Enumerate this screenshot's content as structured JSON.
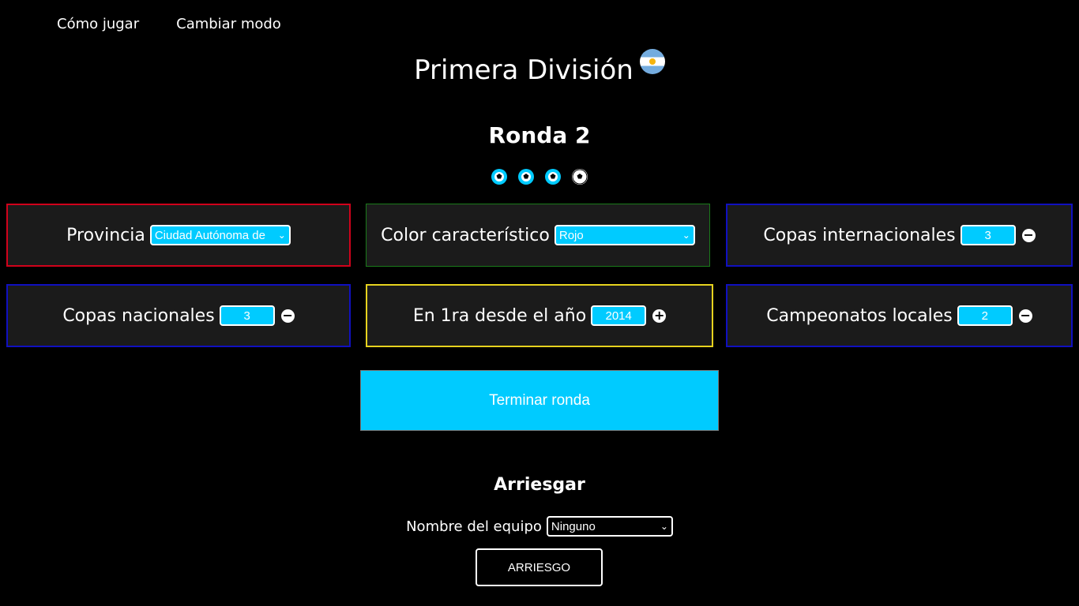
{
  "nav": {
    "how_to_play": "Cómo jugar",
    "change_mode": "Cambiar modo"
  },
  "header": {
    "title": "Primera División",
    "flag_icon": "argentina-flag-icon"
  },
  "round": {
    "label": "Ronda 2",
    "balls": [
      "filled",
      "filled",
      "filled",
      "empty"
    ],
    "ball_color": "#00cbff"
  },
  "cards": {
    "province": {
      "label": "Provincia",
      "value": "Ciudad Autónoma de",
      "border": "#d0021b"
    },
    "color": {
      "label": "Color característico",
      "value": "Rojo",
      "border": "#1a7a1a"
    },
    "intl_cups": {
      "label": "Copas internacionales",
      "value": "3",
      "sign": "−",
      "border": "#1010c0"
    },
    "natl_cups": {
      "label": "Copas nacionales",
      "value": "3",
      "sign": "−",
      "border": "#1010c0"
    },
    "since_year": {
      "label": "En 1ra desde el año",
      "value": "2014",
      "sign": "+",
      "border": "#e6d21e"
    },
    "local_titles": {
      "label": "Campeonatos locales",
      "value": "2",
      "sign": "−",
      "border": "#1010c0"
    }
  },
  "end_round": {
    "label": "Terminar ronda"
  },
  "guess": {
    "title": "Arriesgar",
    "team_label": "Nombre del equipo",
    "team_value": "Ninguno",
    "submit_label": "ARRIESGO"
  }
}
